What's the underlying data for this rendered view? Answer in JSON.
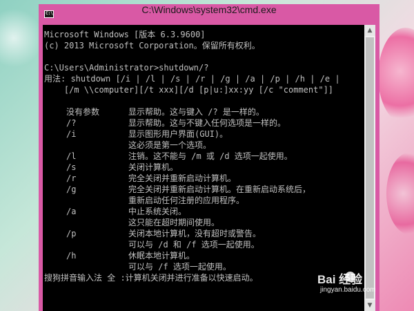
{
  "window": {
    "title": "C:\\Windows\\system32\\cmd.exe",
    "icon": "cmd-icon",
    "titlebar_color": "#d959a5"
  },
  "console": {
    "text_color": "#c0c0c0",
    "background": "#000000",
    "lines": [
      "Microsoft Windows [版本 6.3.9600]",
      "(c) 2013 Microsoft Corporation。保留所有权利。",
      "",
      "C:\\Users\\Administrator>shutdown/?",
      "用法: shutdown [/i | /l | /s | /r | /g | /a | /p | /h | /e |",
      "    [/m \\\\computer][/t xxx][/d [p|u:]xx:yy [/c \"comment\"]]",
      ""
    ],
    "options": [
      {
        "flag": "没有参数",
        "desc": "显示帮助。这与键入 /? 是一样的。"
      },
      {
        "flag": "/?",
        "desc": "显示帮助。这与不键入任何选项是一样的。"
      },
      {
        "flag": "/i",
        "desc": "显示图形用户界面(GUI)。"
      },
      {
        "flag": "",
        "desc": "这必须是第一个选项。"
      },
      {
        "flag": "/l",
        "desc": "注销。这不能与 /m 或 /d 选项一起使用。"
      },
      {
        "flag": "/s",
        "desc": "关闭计算机。"
      },
      {
        "flag": "/r",
        "desc": "完全关闭并重新启动计算机。"
      },
      {
        "flag": "/g",
        "desc": "完全关闭并重新启动计算机。在重新启动系统后，"
      },
      {
        "flag": "",
        "desc": "重新启动任何注册的应用程序。"
      },
      {
        "flag": "/a",
        "desc": "中止系统关闭。"
      },
      {
        "flag": "",
        "desc": "这只能在超时期间使用。"
      },
      {
        "flag": "/p",
        "desc": "关闭本地计算机，没有超时或警告。"
      },
      {
        "flag": "",
        "desc": "可以与 /d 和 /f 选项一起使用。"
      },
      {
        "flag": "/h",
        "desc": "休眠本地计算机。"
      },
      {
        "flag": "",
        "desc": "可以与 /f 选项一起使用。"
      }
    ],
    "ime_status": "搜狗拼音输入法 全 :计算机关闭并进行准备以快速启动。"
  },
  "watermark": {
    "name": "Bai 经验",
    "url": "jingyan.baidu.com"
  }
}
